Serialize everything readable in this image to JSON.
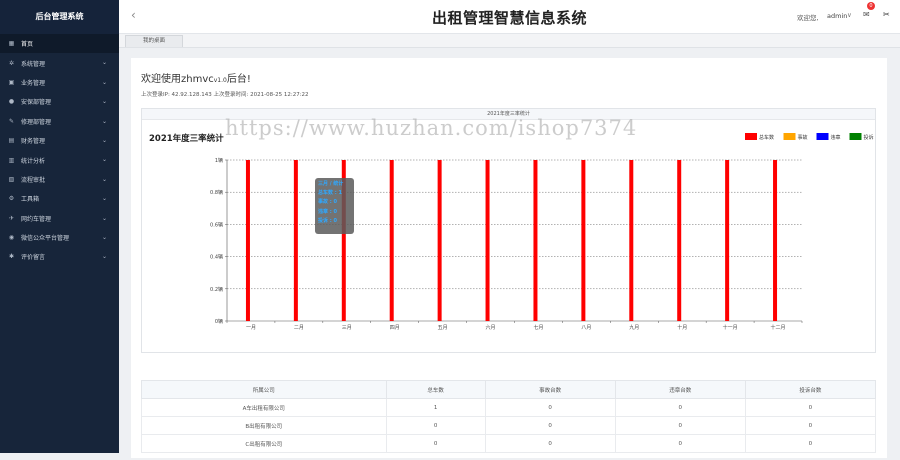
{
  "sidebar": {
    "logo": "后台管理系统",
    "items": [
      {
        "label": "首页",
        "icon": "home-icon",
        "glyph": "▦",
        "has_arrow": false,
        "active": true
      },
      {
        "label": "系统管理",
        "icon": "gear-icon",
        "glyph": "✲",
        "has_arrow": true
      },
      {
        "label": "业务管理",
        "icon": "briefcase-icon",
        "glyph": "▣",
        "has_arrow": true
      },
      {
        "label": "安保部管理",
        "icon": "user-icon",
        "glyph": "●",
        "has_arrow": true
      },
      {
        "label": "修理部管理",
        "icon": "wrench-icon",
        "glyph": "✎",
        "has_arrow": true
      },
      {
        "label": "财务管理",
        "icon": "finance-icon",
        "glyph": "▤",
        "has_arrow": true
      },
      {
        "label": "统计分析",
        "icon": "stats-icon",
        "glyph": "▥",
        "has_arrow": true
      },
      {
        "label": "流程审批",
        "icon": "approval-icon",
        "glyph": "▧",
        "has_arrow": true
      },
      {
        "label": "工具箱",
        "icon": "toolbox-icon",
        "glyph": "⚙",
        "has_arrow": true
      },
      {
        "label": "网约车管理",
        "icon": "car-icon",
        "glyph": "✈",
        "has_arrow": true
      },
      {
        "label": "微信公众平台管理",
        "icon": "wechat-icon",
        "glyph": "◉",
        "has_arrow": true
      },
      {
        "label": "评价留言",
        "icon": "comment-icon",
        "glyph": "✱",
        "has_arrow": true
      }
    ]
  },
  "header": {
    "back_glyph": "‹",
    "title": "出租管理智慧信息系统",
    "welcome": "欢迎您,",
    "user": "admin",
    "user_chevron": "∨",
    "msg_glyph": "✉",
    "msg_count": "0",
    "theme_glyph": "✂"
  },
  "tabs": {
    "desk": "我的桌面"
  },
  "main": {
    "greeting": "欢迎使用zhmvc",
    "version": "v1.0",
    "greeting_suffix": "后台!",
    "login_info": "上次登录IP:  42.92.128.143  上次登录时间:  2021-08-25 12:27:22"
  },
  "watermark": "https://www.huzhan.com/ishop7374",
  "tooltip": {
    "lines": [
      "三月 / 统计",
      "总车数 : 1",
      "事故 : 0",
      "违章 : 0",
      "投诉 : 0"
    ]
  },
  "chart_data": {
    "type": "bar",
    "caption": "2021年度三率统计",
    "title": "2021年度三率统计",
    "categories": [
      "一月",
      "二月",
      "三月",
      "四月",
      "五月",
      "六月",
      "七月",
      "八月",
      "九月",
      "十月",
      "十一月",
      "十二月"
    ],
    "series": [
      {
        "name": "总车数",
        "color": "#ff0000",
        "values": [
          1,
          1,
          1,
          1,
          1,
          1,
          1,
          1,
          1,
          1,
          1,
          1
        ]
      },
      {
        "name": "事故",
        "color": "#ffa500",
        "values": [
          0,
          0,
          0,
          0,
          0,
          0,
          0,
          0,
          0,
          0,
          0,
          0
        ]
      },
      {
        "name": "违章",
        "color": "#0000ff",
        "values": [
          0,
          0,
          0,
          0,
          0,
          0,
          0,
          0,
          0,
          0,
          0,
          0
        ]
      },
      {
        "name": "投诉",
        "color": "#008000",
        "values": [
          0,
          0,
          0,
          0,
          0,
          0,
          0,
          0,
          0,
          0,
          0,
          0
        ]
      }
    ],
    "y_ticks": [
      "0辆",
      "0.2辆",
      "0.4辆",
      "0.6辆",
      "0.8辆",
      "1辆"
    ],
    "ylim": [
      0,
      1
    ],
    "grid": true,
    "legend": "top-right"
  },
  "table": {
    "headers": [
      "所属公司",
      "总车数",
      "事故台数",
      "违章台数",
      "投诉台数"
    ],
    "rows": [
      [
        "A车出租有限公司",
        "1",
        "0",
        "0",
        "0"
      ],
      [
        "B出租有限公司",
        "0",
        "0",
        "0",
        "0"
      ],
      [
        "C出租有限公司",
        "0",
        "0",
        "0",
        "0"
      ]
    ]
  }
}
